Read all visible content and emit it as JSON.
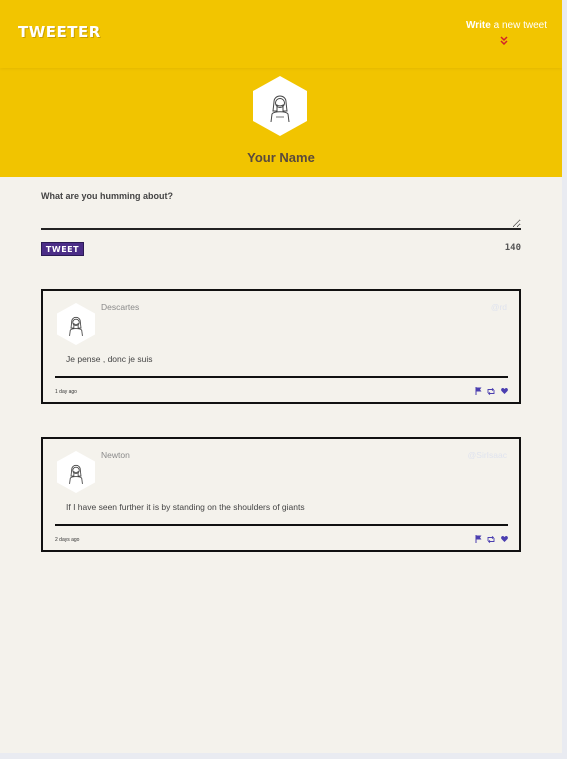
{
  "nav": {
    "logo": "TWEETER",
    "write_bold": "Write",
    "write_rest": " a new tweet",
    "write_icon": "chevron-double-down-icon"
  },
  "profile": {
    "name": "Your Name",
    "avatar_icon": "person-avatar-icon"
  },
  "compose": {
    "label": "What are you humming about?",
    "placeholder": "",
    "value": "",
    "button_label": "TWEET",
    "char_count": "140"
  },
  "tweets": [
    {
      "author": "Descartes",
      "handle": "@rd",
      "content": "Je pense , donc je suis",
      "time": "1 day ago"
    },
    {
      "author": "Newton",
      "handle": "@SirIsaac",
      "content": "If I have seen further it is by standing on the shoulders of giants",
      "time": "2 days ago"
    }
  ],
  "colors": {
    "header": "#f1c400",
    "accent": "#4b2d87",
    "page_bg": "#f4f2ec",
    "action_icons": "#4b3fb0"
  },
  "action_icons": [
    "flag-icon",
    "retweet-icon",
    "heart-icon"
  ]
}
